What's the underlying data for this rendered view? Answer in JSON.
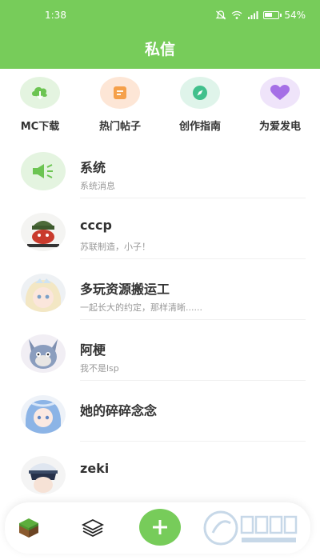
{
  "status_bar": {
    "time": "1:38",
    "battery": "54%"
  },
  "header": {
    "title": "私信"
  },
  "shortcuts": [
    {
      "label": "MC下载",
      "icon": "cloud-download-icon",
      "bg": "#e4f4e0",
      "fg": "#6cc452"
    },
    {
      "label": "热门帖子",
      "icon": "note-icon",
      "bg": "#fde6d6",
      "fg": "#f5a04a"
    },
    {
      "label": "创作指南",
      "icon": "compass-icon",
      "bg": "#dff4ea",
      "fg": "#41c08c"
    },
    {
      "label": "为爱发电",
      "icon": "heart-icon",
      "bg": "#efe4fa",
      "fg": "#a56fe6"
    }
  ],
  "messages": [
    {
      "name": "系统",
      "text": "系统消息"
    },
    {
      "name": "cccp",
      "text": "苏联制造，小子！"
    },
    {
      "name": "多玩资源搬运工",
      "text": "一起长大的约定，那样清晰......"
    },
    {
      "name": "阿梗",
      "text": "我不是lsp"
    },
    {
      "name": "她的碎碎念念",
      "text": ""
    },
    {
      "name": "zeki",
      "text": ""
    }
  ],
  "bottom_nav": {
    "add_label": "+"
  },
  "colors": {
    "accent": "#77cc5a",
    "title": "#333333",
    "subtext": "#999999"
  }
}
